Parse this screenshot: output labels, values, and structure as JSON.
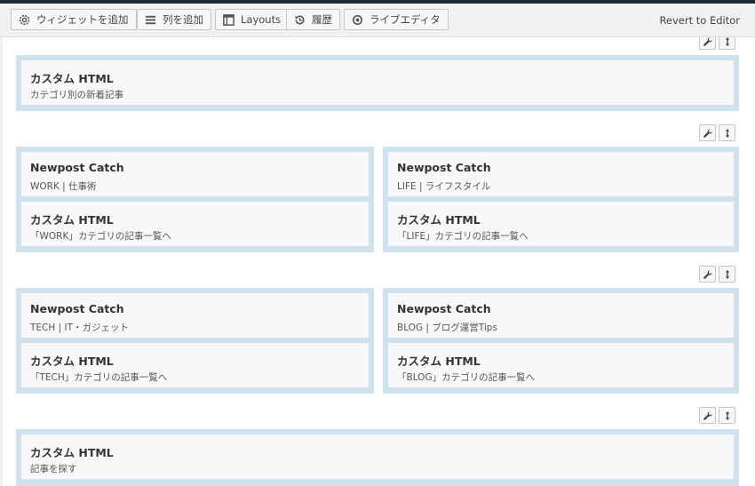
{
  "toolbar": {
    "add_widget": "ウィジェットを追加",
    "add_row": "列を追加",
    "layouts": "Layouts",
    "history": "履歴",
    "live_editor": "ライブエディタ",
    "revert": "Revert to Editor"
  },
  "rows": [
    {
      "cells": [
        {
          "widgets": [
            {
              "title": "カスタム HTML",
              "desc": "カテゴリ別の新着記事"
            }
          ]
        }
      ]
    },
    {
      "cells": [
        {
          "widgets": [
            {
              "title": "Newpost Catch",
              "desc": "WORK | 仕事術"
            },
            {
              "title": "カスタム HTML",
              "desc": "「WORK」カテゴリの記事一覧へ"
            }
          ]
        },
        {
          "widgets": [
            {
              "title": "Newpost Catch",
              "desc": "LIFE | ライフスタイル"
            },
            {
              "title": "カスタム HTML",
              "desc": "「LIFE」カテゴリの記事一覧へ"
            }
          ]
        }
      ]
    },
    {
      "cells": [
        {
          "widgets": [
            {
              "title": "Newpost Catch",
              "desc": "TECH | IT・ガジェット"
            },
            {
              "title": "カスタム HTML",
              "desc": "「TECH」カテゴリの記事一覧へ"
            }
          ]
        },
        {
          "widgets": [
            {
              "title": "Newpost Catch",
              "desc": "BLOG | ブログ運営Tips"
            },
            {
              "title": "カスタム HTML",
              "desc": "「BLOG」カテゴリの記事一覧へ"
            }
          ]
        }
      ]
    },
    {
      "cells": [
        {
          "widgets": [
            {
              "title": "カスタム HTML",
              "desc": "記事を探す"
            }
          ]
        }
      ]
    }
  ]
}
